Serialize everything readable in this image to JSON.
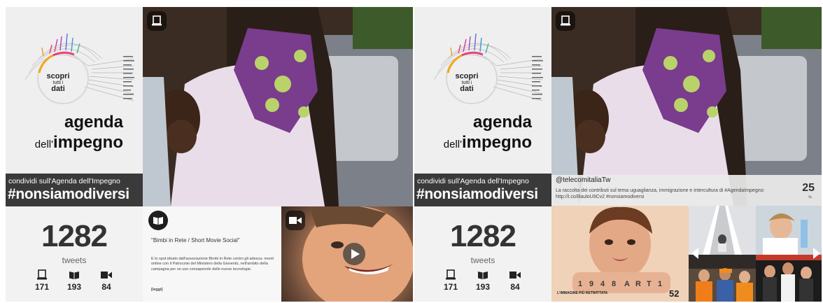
{
  "brand": {
    "scopri_1": "scopri",
    "scopri_2": "tutti i",
    "scopri_3": "dati",
    "title_line1": "agenda",
    "title_dell": "dell'",
    "title_impegno": "impegno"
  },
  "hashtag_bar": {
    "subtitle": "condividi sull'Agenda dell'Impegno",
    "hashtag": "#nonsiamodiversi"
  },
  "counter": {
    "total": "1282",
    "label": "tweets",
    "stats": [
      {
        "icon": "tablet-icon",
        "value": "171"
      },
      {
        "icon": "book-icon",
        "value": "193"
      },
      {
        "icon": "video-camera-icon",
        "value": "84"
      }
    ]
  },
  "card_text": {
    "icon": "book-icon",
    "title": "\"Bimbi in Rete / Short Movie Social\"",
    "body": "E lo spot ideato dall'associazione Bimbi in Rete contro gli adesca- menti online con il Patrocinio del Ministero della Gioventù, nell'ambito della campagna per un uso consapevole delle nuove tecnologie.",
    "more": "[leggi]"
  },
  "card_video": {
    "icon": "video-camera-icon",
    "play_icon": "play-icon"
  },
  "tweet": {
    "user": "@telecomitaliaTw",
    "text": "La raccolta dei contributi sul tema uguaglianza, immigrazione e intercultura di #AgendaImpegno: http://t.co/BauloU9Cv2 #nonsiamodiversi",
    "retweets": "25"
  },
  "featured_image": {
    "caption": "L'IMMAGINE PIÙ RETWITTATA",
    "retweets": "52"
  },
  "colors": {
    "dark_bar": "#3a3a3a",
    "panel_bg": "#f4f4f4",
    "text_dark": "#222222"
  }
}
